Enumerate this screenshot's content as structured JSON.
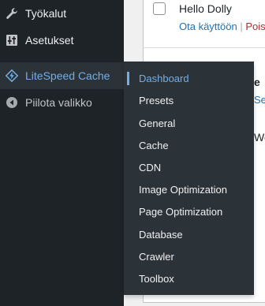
{
  "sidebar": {
    "items": [
      {
        "label": "Työkalut",
        "icon": "wrench-icon"
      },
      {
        "label": "Asetukset",
        "icon": "settings-sliders-icon"
      },
      {
        "label": "LiteSpeed Cache",
        "icon": "litespeed-diamond-icon"
      },
      {
        "label": "Piilota valikko",
        "icon": "collapse-arrow-icon"
      }
    ]
  },
  "content": {
    "plugin_name": "Hello Dolly",
    "activate_label": "Ota käyttöön",
    "separator": " | ",
    "delete_label": "Poist",
    "peek_heading": "e",
    "peek_link": "Se",
    "peek_text": "Wor"
  },
  "flyout": {
    "items": [
      {
        "label": "Dashboard"
      },
      {
        "label": "Presets"
      },
      {
        "label": "General"
      },
      {
        "label": "Cache"
      },
      {
        "label": "CDN"
      },
      {
        "label": "Image Optimization"
      },
      {
        "label": "Page Optimization"
      },
      {
        "label": "Database"
      },
      {
        "label": "Crawler"
      },
      {
        "label": "Toolbox"
      }
    ]
  },
  "colors": {
    "sidebar_bg": "#1d2327",
    "submenu_bg": "#2c3338",
    "accent": "#72aee6",
    "link": "#2271b1",
    "delete": "#b32d2e"
  }
}
